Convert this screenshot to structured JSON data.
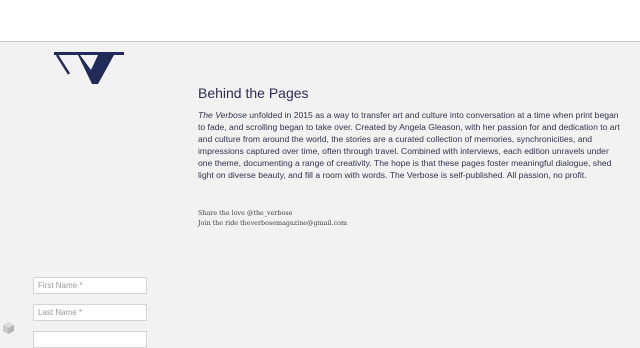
{
  "header": {},
  "logo": {
    "icon": "verbose-logo-mark",
    "color": "#222a5a"
  },
  "section": {
    "title": "Behind the Pages",
    "brand_italic": "The Verbose",
    "body": " unfolded in 2015 as a way to transfer art and culture into conversation at a time when print began to fade, and scrolling began to take over.  Created by Angela Gleason, with her passion for and dedication to art and culture from around the world, the stories are a curated collection of memories, synchronicities, and impressions captured over time, often through travel. Combined with interviews, each edition unravels under one theme, documenting a range of creativity. The hope is that these pages foster meaningful dialogue, shed light on diverse beauty, and fill a room with words.  The Verbose is self-published. All passion, no profit."
  },
  "contact": {
    "share": "Share the love @the_verbose",
    "join": "Join the ride theverbosemagazine@gmail.com"
  },
  "form": {
    "first_name_placeholder": "First Name *",
    "last_name_placeholder": "Last Name *",
    "third_placeholder": ""
  },
  "corner": {
    "icon": "cube-icon"
  }
}
